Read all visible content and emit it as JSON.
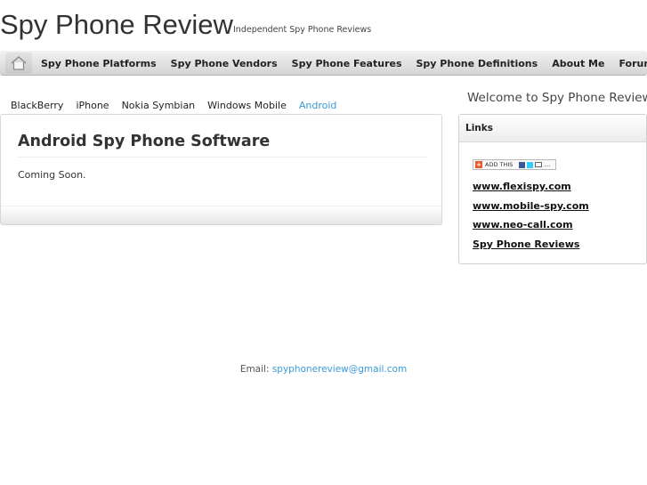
{
  "header": {
    "title": "Spy Phone Review",
    "tagline": "Independent Spy Phone Reviews"
  },
  "nav": {
    "home_icon": "home-icon",
    "items": [
      "Spy Phone Platforms",
      "Spy Phone Vendors",
      "Spy Phone Features",
      "Spy Phone Definitions",
      "About Me",
      "Forum"
    ]
  },
  "subnav": {
    "items": [
      "BlackBerry",
      "iPhone",
      "Nokia Symbian",
      "Windows Mobile",
      "Android"
    ],
    "active": "Android",
    "active_color": "#3a9ad9"
  },
  "post": {
    "title": "Android Spy Phone Software",
    "body": "Coming Soon."
  },
  "sidebar": {
    "welcome": "Welcome to Spy Phone Review",
    "links_heading": "Links",
    "addthis_label": "ADD THIS",
    "links": [
      "www.flexispy.com",
      "www.mobile-spy.com",
      "www.neo-call.com",
      "Spy Phone Reviews"
    ]
  },
  "footer": {
    "label": "Email:",
    "email": "spyphonereview@gmail.com"
  }
}
